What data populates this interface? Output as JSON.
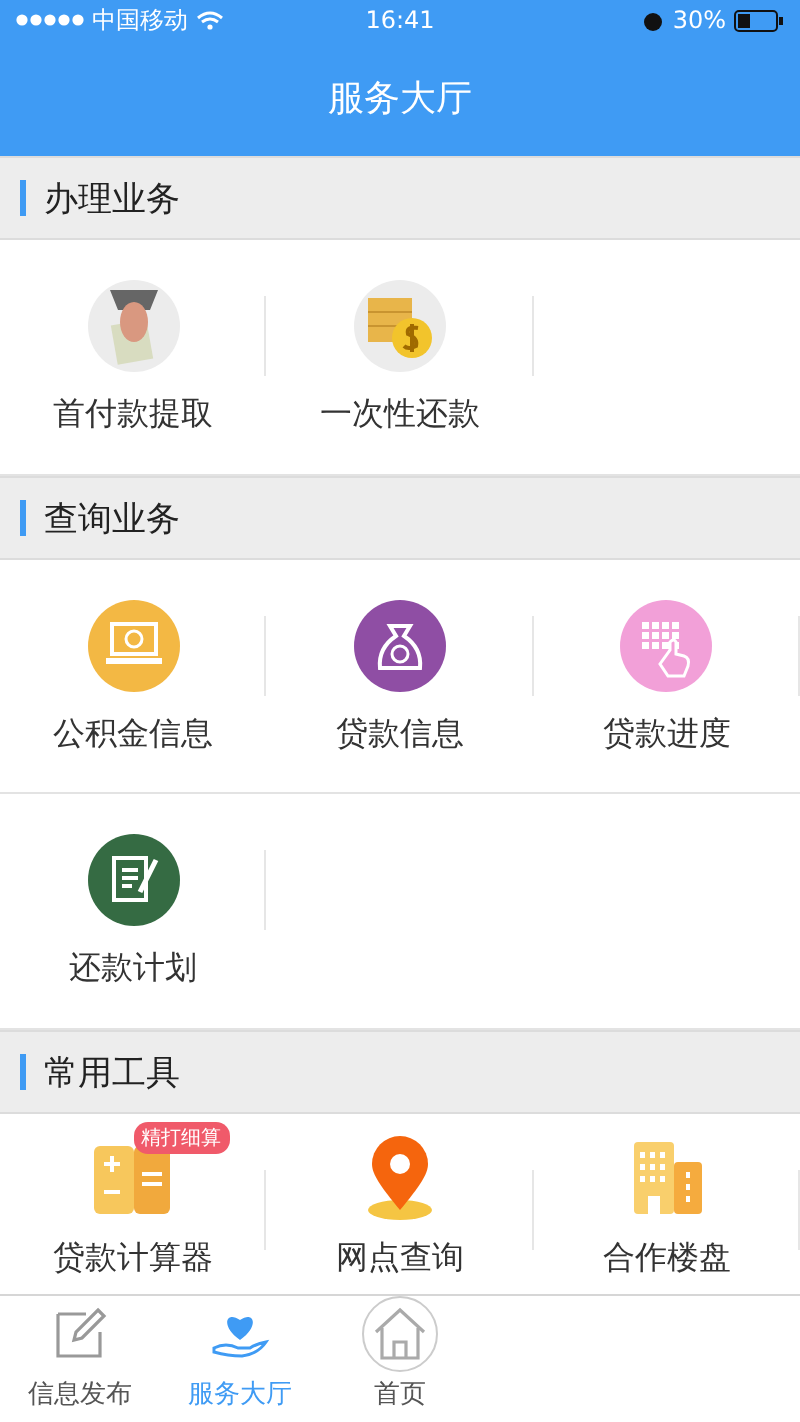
{
  "status_bar": {
    "carrier": "中国移动",
    "time": "16:41",
    "battery": "30%"
  },
  "title": "服务大厅",
  "sections": [
    {
      "title": "办理业务",
      "rows": [
        [
          {
            "label": "首付款提取"
          },
          {
            "label": "一次性还款"
          }
        ]
      ]
    },
    {
      "title": "查询业务",
      "rows": [
        [
          {
            "label": "公积金信息"
          },
          {
            "label": "贷款信息"
          },
          {
            "label": "贷款进度"
          }
        ],
        [
          {
            "label": "还款计划"
          }
        ]
      ]
    },
    {
      "title": "常用工具",
      "rows": [
        [
          {
            "label": "贷款计算器",
            "badge": "精打细算"
          },
          {
            "label": "网点查询"
          },
          {
            "label": "合作楼盘"
          }
        ]
      ]
    }
  ],
  "tabs": [
    {
      "label": "信息发布",
      "selected": false
    },
    {
      "label": "服务大厅",
      "selected": true
    },
    {
      "label": "首页",
      "selected": false
    }
  ]
}
